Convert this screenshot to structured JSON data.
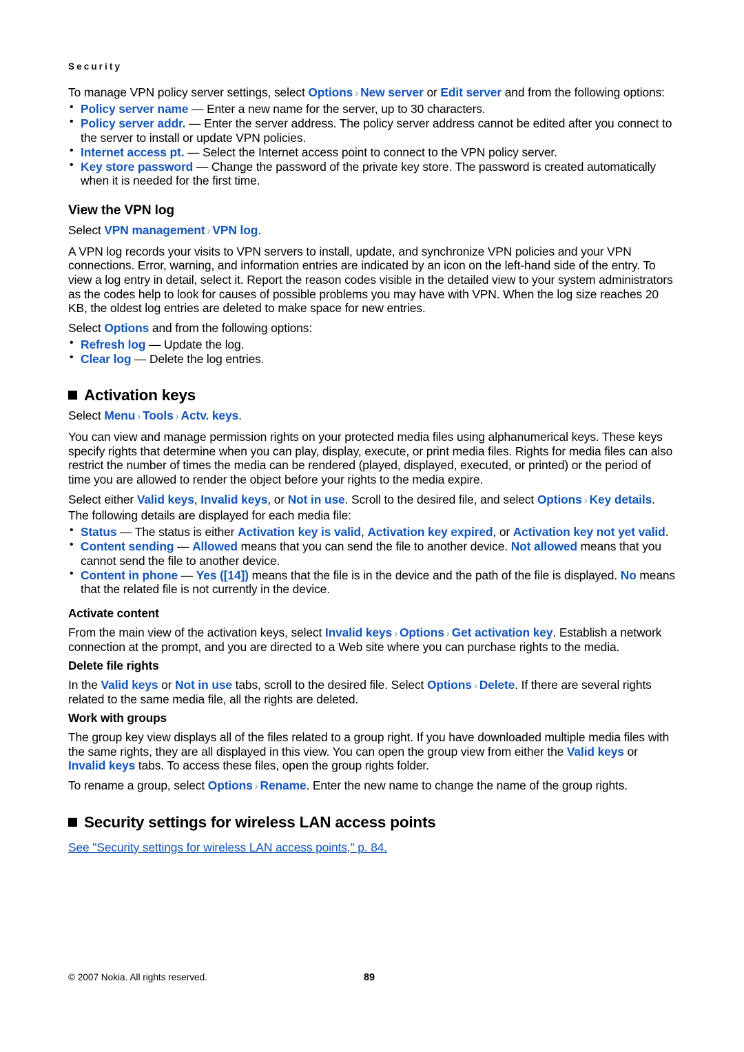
{
  "page": {
    "running_head": "Security",
    "number": "89",
    "copyright": "© 2007 Nokia. All rights reserved.",
    "accent_color": "#1455b8",
    "separator_glyph": "›"
  },
  "intro": {
    "lead_1": "To manage VPN policy server settings, select ",
    "opt_options": "Options",
    "opt_new_server": "New server",
    "lead_or": " or ",
    "opt_edit_server": "Edit server",
    "lead_2": " and from the following options:",
    "bullets": [
      {
        "term": "Policy server name",
        "desc": " — Enter a new name for the server, up to 30 characters."
      },
      {
        "term": "Policy server addr.",
        "desc": " — Enter the server address. The policy server address cannot be edited after you connect to the server to install or update VPN policies."
      },
      {
        "term": "Internet access pt.",
        "desc": " — Select the Internet access point to connect to the VPN policy server."
      },
      {
        "term": "Key store password",
        "desc": " — Change the password of the private key store. The password is created automatically when it is needed for the first time."
      }
    ]
  },
  "vpn_log": {
    "heading": "View the VPN log",
    "select_prefix": "Select ",
    "path_1": "VPN management",
    "path_2": "VPN log",
    "select_suffix": ".",
    "body": "A VPN log records your visits to VPN servers to install, update, and synchronize VPN policies and your VPN connections. Error, warning, and information entries are indicated by an icon on the left-hand side of the entry. To view a log entry in detail, select it. Report the reason codes visible in the detailed view to your system administrators as the codes help to look for causes of possible problems you may have with VPN. When the log size reaches 20 KB, the oldest log entries are deleted to make space for new entries.",
    "options_prefix": "Select ",
    "options_label": "Options",
    "options_suffix": " and from the following options:",
    "bullets": [
      {
        "term": "Refresh log",
        "desc": " — Update the log."
      },
      {
        "term": "Clear log",
        "desc": " — Delete the log entries."
      }
    ]
  },
  "activation_keys": {
    "heading": "Activation keys",
    "select_prefix": "Select ",
    "path_1": "Menu",
    "path_2": "Tools",
    "path_3": "Actv. keys",
    "select_suffix": ".",
    "body": "You can view and manage permission rights on your protected media files using alphanumerical keys. These keys specify rights that determine when you can play, display, execute, or print media files. Rights for media files can also restrict the number of times the media can be rendered (played, displayed, executed, or printed) or the period of time you are allowed to render the object before your rights to the media expire.",
    "select_either_prefix": "Select either ",
    "tab_valid": "Valid keys",
    "comma_1": ", ",
    "tab_invalid": "Invalid keys",
    "comma_or": ", or ",
    "tab_not_in_use": "Not in use",
    "scroll_text": ". Scroll to the desired file, and select ",
    "opt_options": "Options",
    "opt_key_details": "Key details",
    "period": ".",
    "details_intro": "The following details are displayed for each media file:",
    "detail_bullets": [
      {
        "term": "Status",
        "mid_1": " — The status is either ",
        "val_1": "Activation key is valid",
        "mid_2": ", ",
        "val_2": "Activation key expired",
        "mid_3": ", or ",
        "val_3": "Activation key not yet valid",
        "tail": "."
      },
      {
        "term": "Content sending",
        "mid_1": " — ",
        "val_1": "Allowed",
        "mid_2": " means that you can send the file to another device. ",
        "val_2": "Not allowed",
        "mid_3": " means that you cannot send the file to another device.",
        "val_3": "",
        "tail": ""
      },
      {
        "term": "Content in phone",
        "mid_1": " — ",
        "val_1": "Yes ([14])",
        "mid_2": " means that the file is in the device and the path of the file is displayed. ",
        "val_2": "No",
        "mid_3": " means that the related file is not currently in the device.",
        "val_3": "",
        "tail": ""
      }
    ]
  },
  "activate_content": {
    "heading": "Activate content",
    "prefix": "From the main view of the activation keys, select ",
    "path_1": "Invalid keys",
    "path_2": "Options",
    "path_3": "Get activation key",
    "suffix": ". Establish a network connection at the prompt, and you are directed to a Web site where you can purchase rights to the media."
  },
  "delete_file_rights": {
    "heading": "Delete file rights",
    "prefix": "In the ",
    "tab_valid": "Valid keys",
    "mid_or": " or ",
    "tab_not_in_use": "Not in use",
    "mid_2": " tabs, scroll to the desired file. Select ",
    "opt_options": "Options",
    "opt_delete": "Delete",
    "suffix": ". If there are several rights related to the same media file, all the rights are deleted."
  },
  "work_with_groups": {
    "heading": "Work with groups",
    "para_1_prefix": "The group key view displays all of the files related to a group right. If you have downloaded multiple media files with the same rights, they are all displayed in this view. You can open the group view from either the ",
    "tab_valid": "Valid keys",
    "mid_or": " or ",
    "tab_invalid": "Invalid keys",
    "para_1_suffix": " tabs. To access these files, open the group rights folder.",
    "para_2_prefix": "To rename a group, select ",
    "opt_options": "Options",
    "opt_rename": "Rename",
    "para_2_suffix": ". Enter the new name to change the name of the group rights."
  },
  "wlan_section": {
    "heading": "Security settings for wireless LAN access points",
    "xref": "See \"Security settings for wireless LAN access points,\" p. 84."
  }
}
